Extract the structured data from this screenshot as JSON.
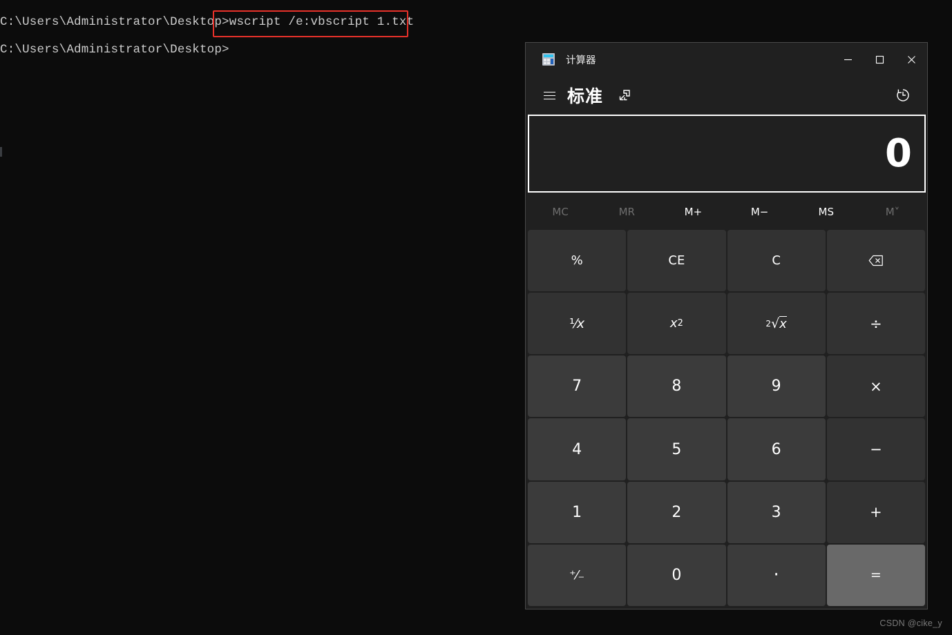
{
  "terminal": {
    "lines": [
      "C:\\Users\\Administrator\\Desktop>wscript /e:vbscript 1.txt",
      "C:\\Users\\Administrator\\Desktop>"
    ],
    "highlighted_command": "wscript /e:vbscript 1.txt",
    "highlight_color": "#e8312a",
    "background_color": "#0c0c0c",
    "text_color": "#cccccc"
  },
  "watermark": {
    "text": "CSDN @cike_y"
  },
  "calculator": {
    "window_title": "计算器",
    "app_icon": "calculator-icon",
    "window_controls": {
      "minimize": "minimize-icon",
      "maximize": "maximize-icon",
      "close": "close-icon"
    },
    "mode_label": "标准",
    "menu_icon": "hamburger-menu-icon",
    "keep_on_top_icon": "keep-on-top-icon",
    "history_icon": "history-clock-icon",
    "display": {
      "value": "0",
      "focused": true
    },
    "memory": [
      {
        "label": "MC",
        "enabled": false
      },
      {
        "label": "MR",
        "enabled": false
      },
      {
        "label": "M+",
        "enabled": true
      },
      {
        "label": "M−",
        "enabled": true
      },
      {
        "label": "MS",
        "enabled": true
      },
      {
        "label": "M˅",
        "enabled": false
      }
    ],
    "keys": [
      {
        "label": "%",
        "name": "percent",
        "type": "func"
      },
      {
        "label": "CE",
        "name": "clear-entry",
        "type": "func"
      },
      {
        "label": "C",
        "name": "clear",
        "type": "func"
      },
      {
        "label": "⌫",
        "name": "backspace",
        "type": "func"
      },
      {
        "label": "1/x",
        "name": "reciprocal",
        "type": "func"
      },
      {
        "label": "x²",
        "name": "square",
        "type": "func"
      },
      {
        "label": "²√x",
        "name": "square-root",
        "type": "func"
      },
      {
        "label": "÷",
        "name": "divide",
        "type": "op"
      },
      {
        "label": "7",
        "name": "seven",
        "type": "num"
      },
      {
        "label": "8",
        "name": "eight",
        "type": "num"
      },
      {
        "label": "9",
        "name": "nine",
        "type": "num"
      },
      {
        "label": "×",
        "name": "multiply",
        "type": "op"
      },
      {
        "label": "4",
        "name": "four",
        "type": "num"
      },
      {
        "label": "5",
        "name": "five",
        "type": "num"
      },
      {
        "label": "6",
        "name": "six",
        "type": "num"
      },
      {
        "label": "−",
        "name": "subtract",
        "type": "op"
      },
      {
        "label": "1",
        "name": "one",
        "type": "num"
      },
      {
        "label": "2",
        "name": "two",
        "type": "num"
      },
      {
        "label": "3",
        "name": "three",
        "type": "num"
      },
      {
        "label": "+",
        "name": "add",
        "type": "op"
      },
      {
        "label": "+/-",
        "name": "negate",
        "type": "num"
      },
      {
        "label": "0",
        "name": "zero",
        "type": "num"
      },
      {
        "label": ".",
        "name": "decimal",
        "type": "num"
      },
      {
        "label": "=",
        "name": "equals",
        "type": "equals"
      }
    ],
    "colors": {
      "window_background": "#202020",
      "number_key": "#3b3b3b",
      "function_key": "#323232",
      "equals_key": "#696969",
      "text": "#ffffff",
      "disabled_text": "#6e6e6e"
    }
  }
}
